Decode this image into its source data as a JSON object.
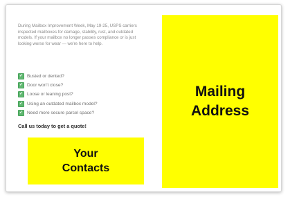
{
  "intro": "During Mailbox Improvement Week, May 19-25, USPS carriers inspected mailboxes for damage, stability, rust, and outdated models. If your mailbox no longer passes compliance or is just looking worse for wear — we're here to help.",
  "checklist": [
    "Busted or dented?",
    "Door won't close?",
    "Loose or leaning post?",
    "Using an outdated mailbox model?",
    "Need more secure parcel space?"
  ],
  "check_icon": "check-icon",
  "cta": "Call us today to get a quote!",
  "mailing_address": "Mailing\nAddress",
  "your_contacts": "Your\nContacts",
  "colors": {
    "placeholder_yellow": "#ffff00",
    "check_green": "#62b872"
  }
}
